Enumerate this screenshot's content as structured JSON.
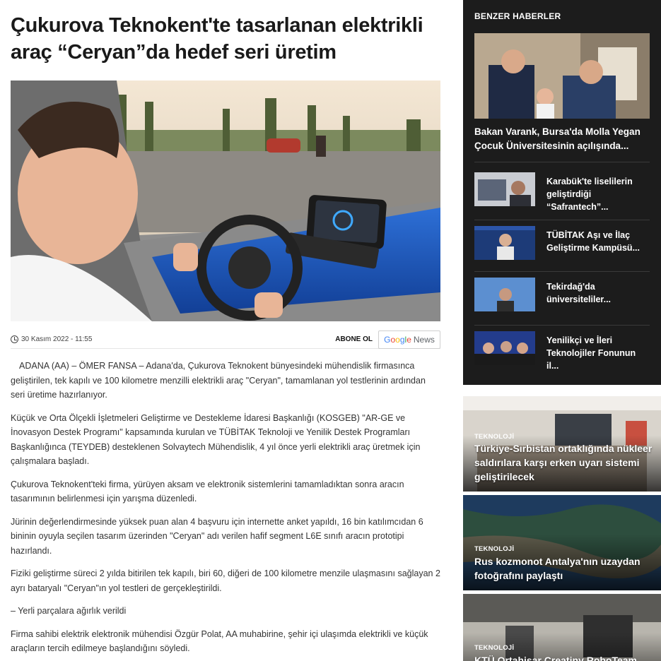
{
  "article": {
    "title": "Çukurova Teknokent'te tasarlanan elektrikli araç “Ceryan”da hedef seri üretim",
    "date": "30 Kasım 2022 - 11:55",
    "subscribe_label": "ABONE OL",
    "google_news": {
      "g1": "G",
      "o1": "o",
      "o2": "o",
      "g2": "g",
      "l": "l",
      "e": "e",
      "news": "News"
    },
    "paragraphs": [
      "ADANA (AA) – ÖMER FANSA – Adana'da, Çukurova Teknokent bünyesindeki mühendislik firmasınca geliştirilen, tek kapılı ve 100 kilometre menzilli elektrikli araç \"Ceryan\", tamamlanan yol testlerinin ardından seri üretime hazırlanıyor.",
      "Küçük ve Orta Ölçekli İşletmeleri Geliştirme ve Destekleme İdaresi Başkanlığı (KOSGEB) \"AR-GE ve İnovasyon Destek Programı\" kapsamında kurulan ve TÜBİTAK Teknoloji ve Yenilik Destek Programları Başkanlığınca (TEYDEB) desteklenen Solvaytech Mühendislik, 4 yıl önce yerli elektrikli araç üretmek için çalışmalara başladı.",
      "Çukurova Teknokent'teki firma, yürüyen aksam ve elektronik sistemlerini tamamladıktan sonra aracın tasarımının belirlenmesi için yarışma düzenledi.",
      "Jürinin değerlendirmesinde yüksek puan alan 4 başvuru için internette anket yapıldı, 16 bin katılımcıdan 6 bininin oyuyla seçilen tasarım üzerinden \"Ceryan\" adı verilen hafif segment L6E sınıfı aracın prototipi hazırlandı.",
      "Fiziki geliştirme süreci 2 yılda bitirilen tek kapılı, biri 60, diğeri de 100 kilometre menzile ulaşmasını sağlayan 2 ayrı bataryalı \"Ceryan\"ın yol testleri de gerçekleştirildi.",
      "– Yerli parçalara ağırlık verildi",
      "Firma sahibi elektrik elektronik mühendisi Özgür Polat, AA muhabirine, şehir içi ulaşımda elektrikli ve küçük araçların tercih edilmeye başlandığını söyledi."
    ]
  },
  "sidebar": {
    "title": "BENZER HABERLER",
    "feature": {
      "title": "Bakan Varank, Bursa'da Molla Yegan Çocuk Üniversitesinin açılışında..."
    },
    "items": [
      {
        "title": "Karabük'te liselilerin geliştirdiği “Safrantech”..."
      },
      {
        "title": "TÜBİTAK Aşı ve İlaç Geliştirme Kampüsü..."
      },
      {
        "title": "Tekirdağ'da üniversiteliler..."
      },
      {
        "title": "Yenilikçi ve İleri Teknolojiler Fonunun il..."
      }
    ]
  },
  "cards": [
    {
      "category": "TEKNOLOJİ",
      "title": "Türkiye-Sırbistan ortaklığında nükleer saldırılara karşı erken uyarı sistemi geliştirilecek"
    },
    {
      "category": "TEKNOLOJİ",
      "title": "Rus kozmonot Antalya'nın uzaydan fotoğrafını paylaştı"
    },
    {
      "category": "TEKNOLOJİ",
      "title": "KTÜ Ortahisar Creatiny RoboTeam"
    }
  ]
}
